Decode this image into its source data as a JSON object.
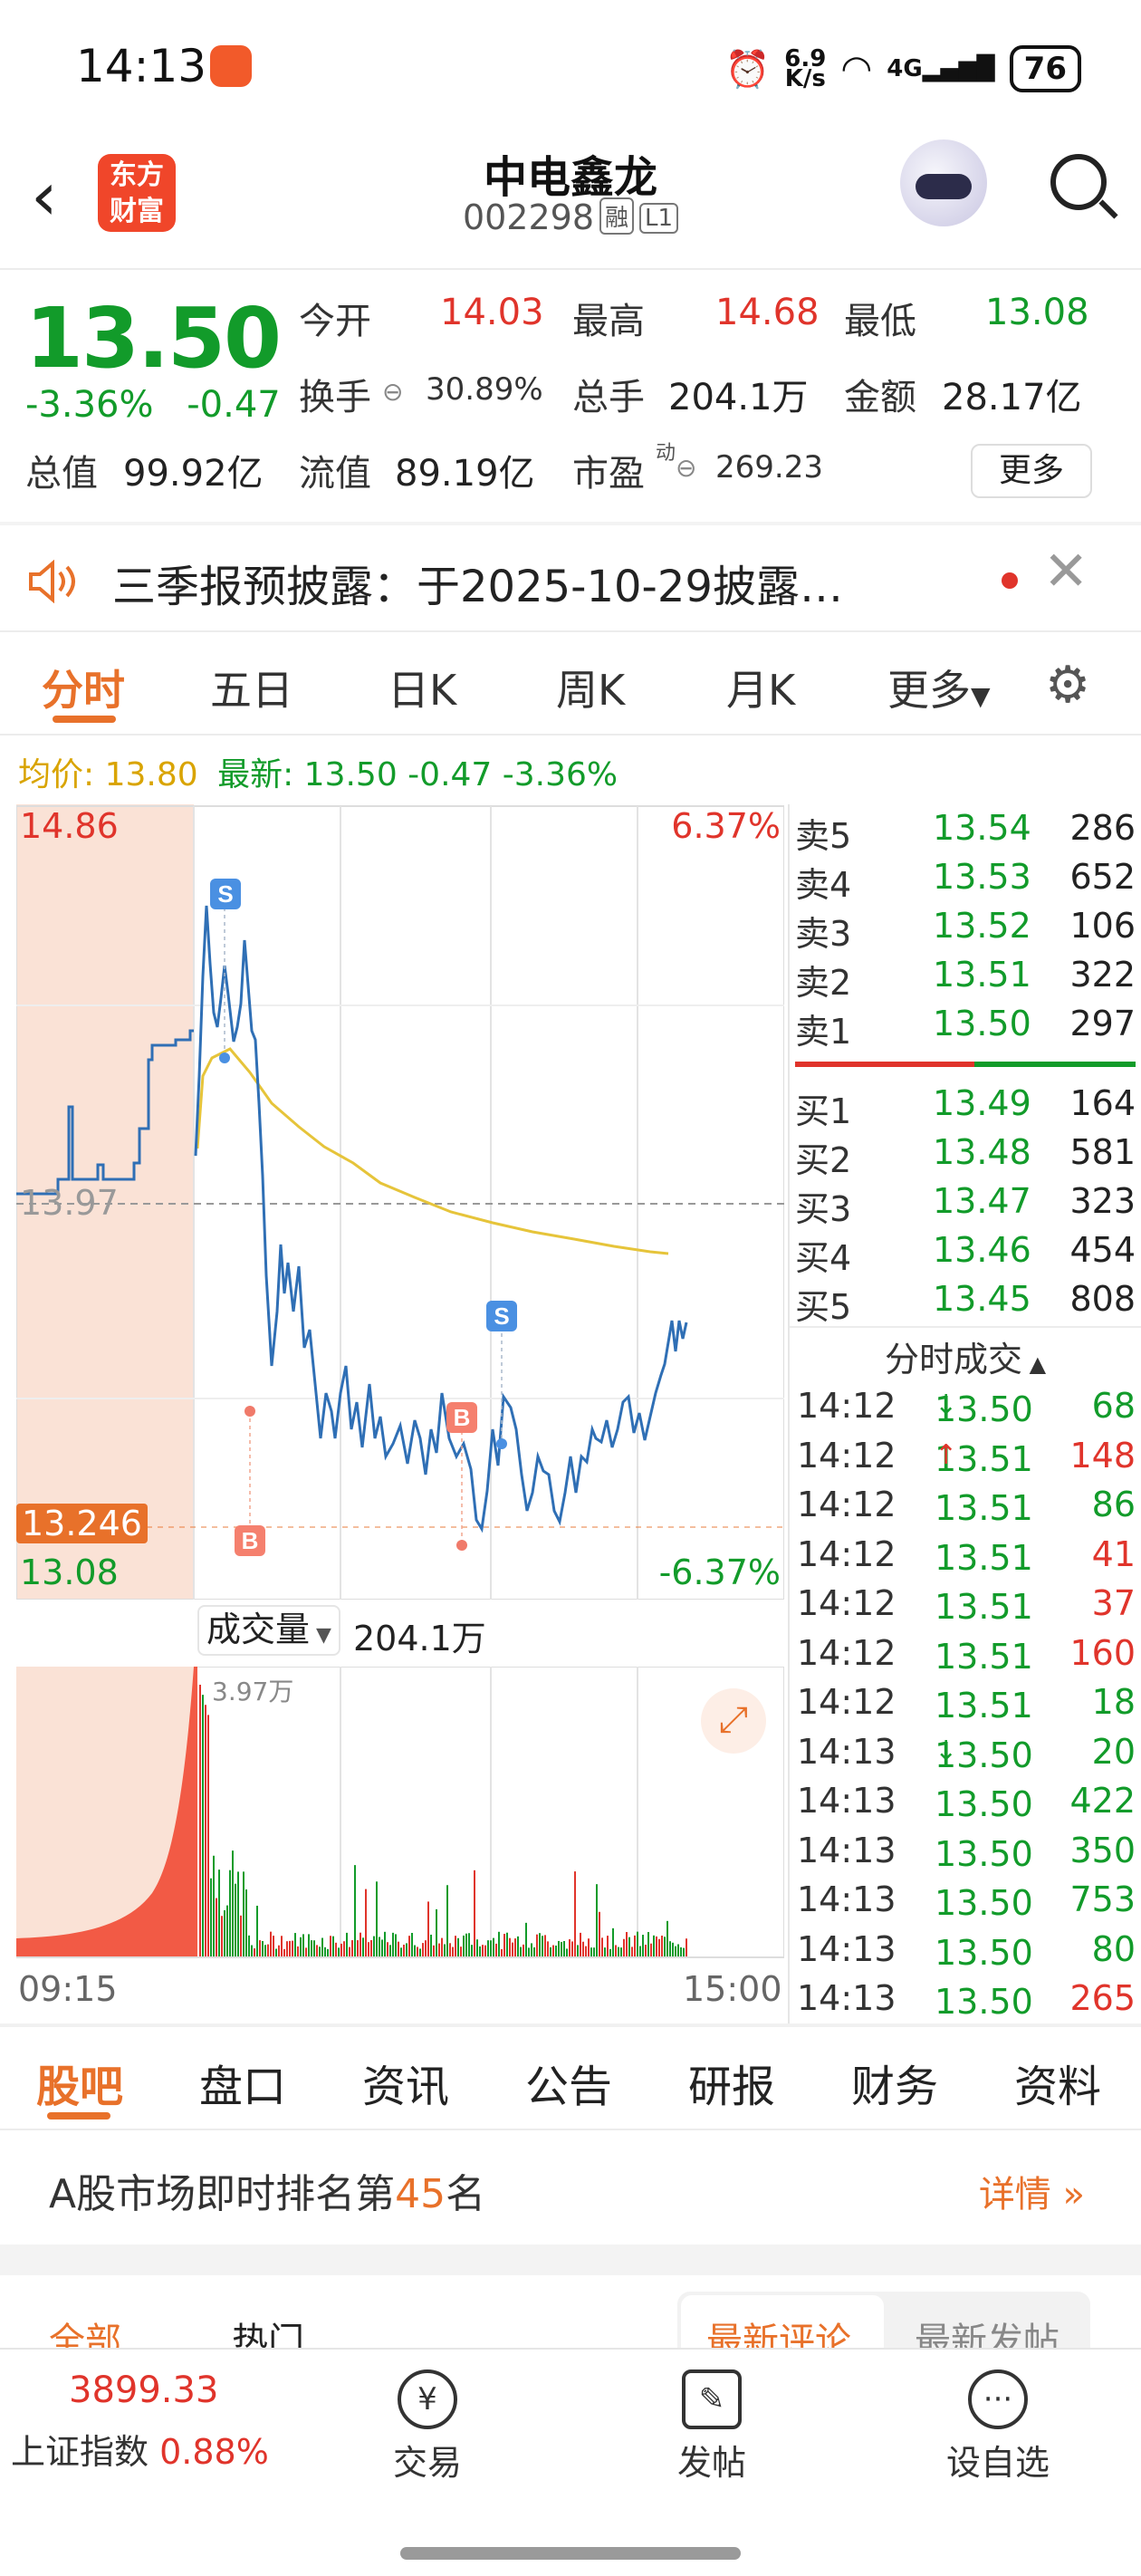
{
  "status_bar": {
    "time": "14:13",
    "net_speed_value": "6.9",
    "net_speed_unit": "K/s",
    "network": "4G",
    "battery": "76"
  },
  "header": {
    "logo_line1": "东方",
    "logo_line2": "财富",
    "stock_name": "中电鑫龙",
    "stock_code": "002298",
    "tag_margin": "融",
    "tag_level": "L1"
  },
  "quote": {
    "price": "13.50",
    "change_pct": "-3.36%",
    "change_amt": "-0.47",
    "open_label": "今开",
    "open": "14.03",
    "high_label": "最高",
    "high": "14.68",
    "low_label": "最低",
    "low": "13.08",
    "turnover_label": "换手",
    "turnover": "30.89%",
    "volume_label": "总手",
    "volume": "204.1万",
    "amount_label": "金额",
    "amount": "28.17亿",
    "mktcap_label": "总值",
    "mktcap": "99.92亿",
    "float_label": "流值",
    "float": "89.19亿",
    "pe_label": "市盈",
    "pe_sup": "动",
    "pe": "269.23",
    "more_btn": "更多"
  },
  "notice": {
    "text": "三季报预披露：于2025-10-29披露…"
  },
  "chart_tabs": [
    "分时",
    "五日",
    "日K",
    "周K",
    "月K",
    "更多"
  ],
  "avg_line": {
    "avg_label": "均价: 13.80",
    "latest_label": "最新: 13.50 -0.47 -3.36%"
  },
  "chart_labels": {
    "top_price": "14.86",
    "top_pct": "6.37%",
    "mid_price": "13.97",
    "cursor_price": "13.246",
    "bottom_price": "13.08",
    "bottom_pct": "-6.37%",
    "volume_btn": "成交量",
    "volume_total": "204.1万",
    "vol_scale": "3.97万",
    "time_start": "09:15",
    "time_end": "15:00",
    "marker_s": "S",
    "marker_b": "B"
  },
  "order_book": {
    "asks": [
      {
        "label": "卖5",
        "price": "13.54",
        "vol": "286"
      },
      {
        "label": "卖4",
        "price": "13.53",
        "vol": "652"
      },
      {
        "label": "卖3",
        "price": "13.52",
        "vol": "106"
      },
      {
        "label": "卖2",
        "price": "13.51",
        "vol": "322"
      },
      {
        "label": "卖1",
        "price": "13.50",
        "vol": "297"
      }
    ],
    "bids": [
      {
        "label": "买1",
        "price": "13.49",
        "vol": "164"
      },
      {
        "label": "买2",
        "price": "13.48",
        "vol": "581"
      },
      {
        "label": "买3",
        "price": "13.47",
        "vol": "323"
      },
      {
        "label": "买4",
        "price": "13.46",
        "vol": "454"
      },
      {
        "label": "买5",
        "price": "13.45",
        "vol": "808"
      }
    ]
  },
  "ticks_title": "分时成交",
  "ticks": [
    {
      "time": "14:12",
      "price": "13.50",
      "arrow": "↓",
      "vol": "68",
      "color": "#129b2a"
    },
    {
      "time": "14:12",
      "price": "13.51",
      "arrow": "↑",
      "vol": "148",
      "color": "#e0342b"
    },
    {
      "time": "14:12",
      "price": "13.51",
      "arrow": "",
      "vol": "86",
      "color": "#129b2a"
    },
    {
      "time": "14:12",
      "price": "13.51",
      "arrow": "",
      "vol": "41",
      "color": "#e0342b"
    },
    {
      "time": "14:12",
      "price": "13.51",
      "arrow": "",
      "vol": "37",
      "color": "#e0342b"
    },
    {
      "time": "14:12",
      "price": "13.51",
      "arrow": "",
      "vol": "160",
      "color": "#e0342b"
    },
    {
      "time": "14:12",
      "price": "13.51",
      "arrow": "",
      "vol": "18",
      "color": "#129b2a"
    },
    {
      "time": "14:13",
      "price": "13.50",
      "arrow": "↓",
      "vol": "20",
      "color": "#129b2a"
    },
    {
      "time": "14:13",
      "price": "13.50",
      "arrow": "",
      "vol": "422",
      "color": "#129b2a"
    },
    {
      "time": "14:13",
      "price": "13.50",
      "arrow": "",
      "vol": "350",
      "color": "#129b2a"
    },
    {
      "time": "14:13",
      "price": "13.50",
      "arrow": "",
      "vol": "753",
      "color": "#129b2a"
    },
    {
      "time": "14:13",
      "price": "13.50",
      "arrow": "",
      "vol": "80",
      "color": "#129b2a"
    },
    {
      "time": "14:13",
      "price": "13.50",
      "arrow": "",
      "vol": "265",
      "color": "#e0342b"
    }
  ],
  "bottom_tabs": [
    "股吧",
    "盘口",
    "资讯",
    "公告",
    "研报",
    "财务",
    "资料"
  ],
  "rank": {
    "prefix": "A股市场即时排名第",
    "number": "45",
    "suffix": "名",
    "detail": "详情"
  },
  "filter": {
    "all": "全部",
    "hot": "热门",
    "latest_comment": "最新评论",
    "latest_post": "最新发帖"
  },
  "bottom_nav": {
    "index_value": "3899.33",
    "index_name": "上证指数",
    "index_pct": "0.88%",
    "trade": "交易",
    "post": "发帖",
    "watchlist": "设自选"
  },
  "colors": {
    "up": "#e0342b",
    "down": "#129b2a",
    "accent": "#e8712a",
    "price_line": "#2f6fb5",
    "avg_line": "#e6c43a"
  }
}
